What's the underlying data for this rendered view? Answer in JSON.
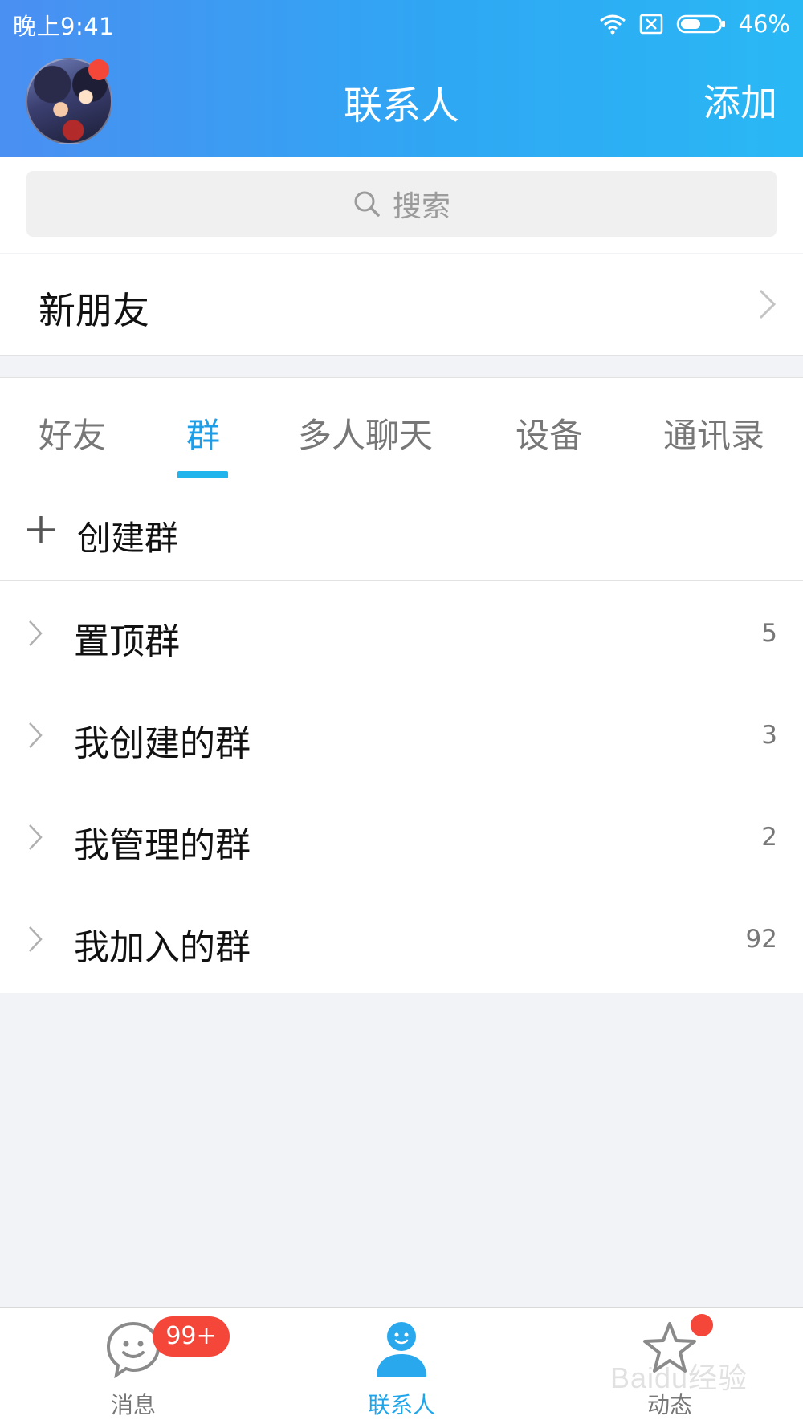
{
  "status_bar": {
    "time": "晚上9:41",
    "battery": "46%"
  },
  "header": {
    "title": "联系人",
    "add_label": "添加"
  },
  "search": {
    "placeholder": "搜索"
  },
  "new_friends": {
    "label": "新朋友"
  },
  "tabs": [
    {
      "label": "好友",
      "active": false
    },
    {
      "label": "群",
      "active": true
    },
    {
      "label": "多人聊天",
      "active": false
    },
    {
      "label": "设备",
      "active": false
    },
    {
      "label": "通讯录",
      "active": false
    }
  ],
  "create_group": {
    "label": "创建群"
  },
  "groups": [
    {
      "name": "置顶群",
      "count": "5"
    },
    {
      "name": "我创建的群",
      "count": "3"
    },
    {
      "name": "我管理的群",
      "count": "2"
    },
    {
      "name": "我加入的群",
      "count": "92"
    }
  ],
  "bottom_nav": [
    {
      "label": "消息",
      "icon": "message-icon",
      "active": false,
      "badge": "99+"
    },
    {
      "label": "联系人",
      "icon": "contacts-icon",
      "active": true
    },
    {
      "label": "动态",
      "icon": "star-icon",
      "active": false,
      "dot": true
    }
  ],
  "watermark": "Baidu经验",
  "colors": {
    "accent": "#1f9ee8",
    "header_start": "#4a8ff2",
    "header_end": "#2ab8f5",
    "badge": "#f5463a"
  }
}
